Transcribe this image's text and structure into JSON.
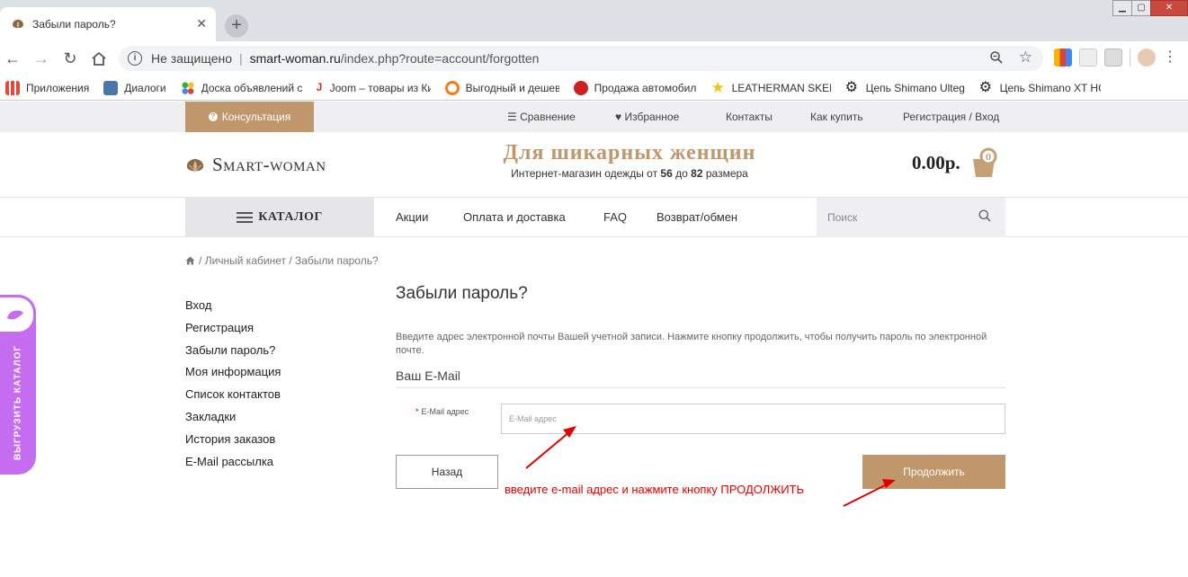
{
  "browser": {
    "tab_title": "Забыли пароль?",
    "tab_close": "✕",
    "new_tab": "+",
    "security_label": "Не защищено",
    "url_domain": "smart-woman.ru",
    "url_path": "/index.php?route=account/forgotten",
    "bookmarks": [
      {
        "label": "Приложения",
        "color": "#e34a3a"
      },
      {
        "label": "Диалоги",
        "color": "#4a76a8"
      },
      {
        "label": "Доска объявлений с",
        "color": "#36a94a"
      },
      {
        "label": "Joom – товары из Ки",
        "color": "#d12d2d"
      },
      {
        "label": "Выгодный и дешевы",
        "color": "#ef7d1a"
      },
      {
        "label": "Продажа автомобил",
        "color": "#cc1f1f"
      },
      {
        "label": "LEATHERMAN SKELE",
        "color": "#f2c318"
      },
      {
        "label": "Цепь Shimano Ulteg",
        "color": "#222222"
      },
      {
        "label": "Цепь Shimano XT HG",
        "color": "#222222"
      }
    ]
  },
  "topbar": {
    "consult_label": "Консультация",
    "links": {
      "compare": "Сравнение",
      "favorites": "Избранное",
      "contacts": "Контакты",
      "how_to_buy": "Как купить",
      "register_login": "Регистрация / Вход"
    }
  },
  "header": {
    "logo_text": "Smart-woman",
    "slogan": "Для шикарных женщин",
    "subslogan_prefix": "Интернет-магазин одежды от",
    "size_from": "56",
    "subslogan_mid": "до",
    "size_to": "82",
    "subslogan_suffix": "размера",
    "cart_amount": "0.00р.",
    "cart_count": "0"
  },
  "menu": {
    "catalog": "КАТАЛОГ",
    "promotions": "Акции",
    "payment_delivery": "Оплата и доставка",
    "faq": "FAQ",
    "returns": "Возврат/обмен",
    "search_placeholder": "Поиск"
  },
  "breadcrumb": {
    "sep": "/",
    "account": "Личный кабинет",
    "current": "Забыли пароль?"
  },
  "sidebar": {
    "items": [
      "Вход",
      "Регистрация",
      "Забыли пароль?",
      "Моя информация",
      "Список контактов",
      "Закладки",
      "История заказов",
      "E-Mail рассылка"
    ]
  },
  "form": {
    "title": "Забыли пароль?",
    "description": "Введите адрес электронной почты Вашей учетной записи. Нажмите кнопку продолжить, чтобы получить пароль по электронной почте.",
    "legend": "Ваш E-Mail",
    "required_mark": "*",
    "email_label": "E-Mail адрес",
    "email_placeholder": "E-Mail адрес",
    "email_value": "",
    "back_label": "Назад",
    "continue_label": "Продолжить"
  },
  "annotation": "введите e-mail адрес и нажмите кнопку ПРОДОЛЖИТЬ",
  "side_widget": {
    "label": "ВЫГРУЗИТЬ КАТАЛОГ"
  },
  "colors": {
    "accent": "#bf976a",
    "annotation": "#e00000",
    "widget": "#c56cf0"
  }
}
